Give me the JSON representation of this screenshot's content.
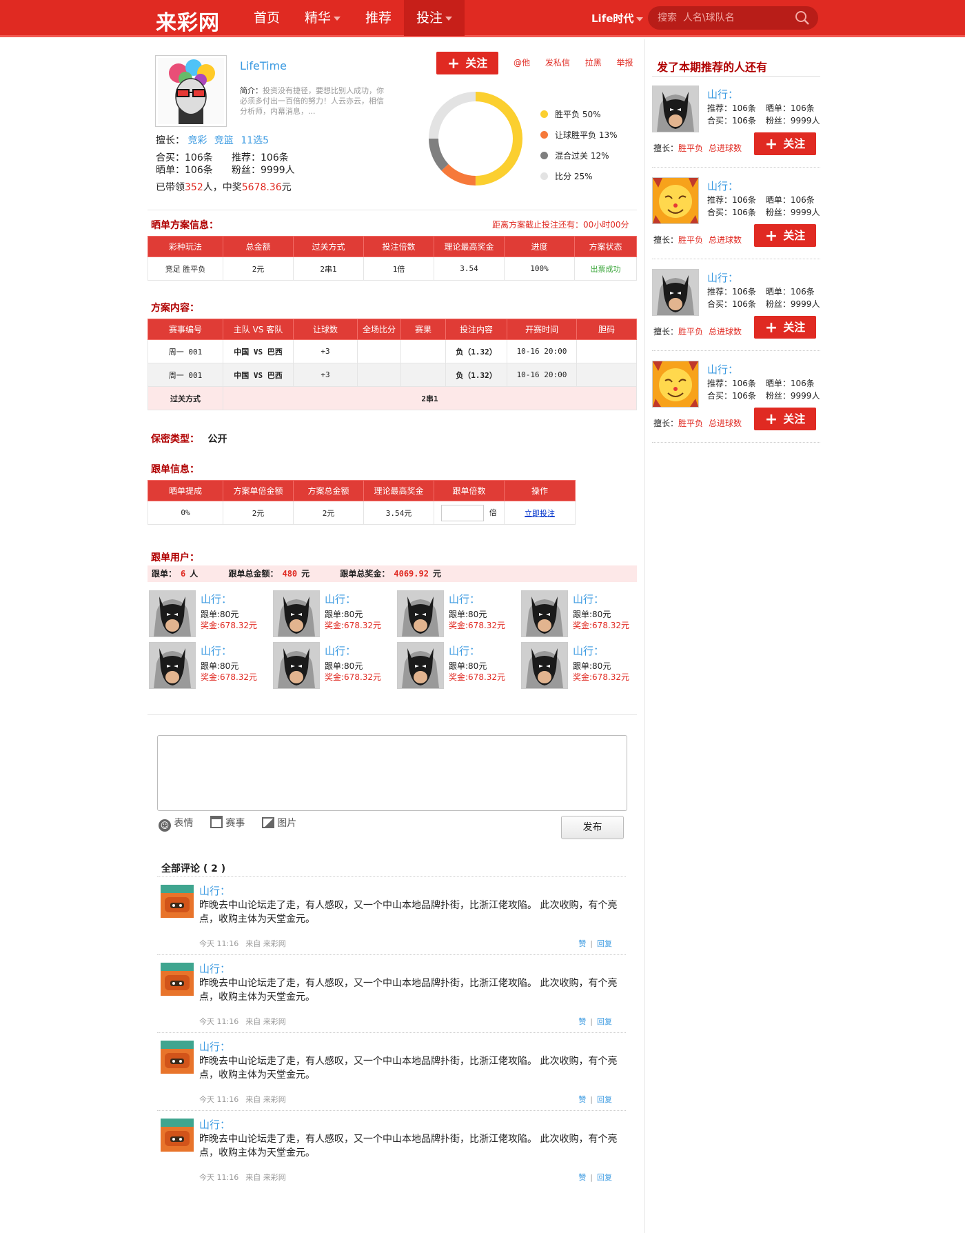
{
  "header": {
    "logo": "来彩网",
    "nav": [
      {
        "label": "首页",
        "caret": false,
        "active": false
      },
      {
        "label": "精华",
        "caret": true,
        "active": false
      },
      {
        "label": "推荐",
        "caret": false,
        "active": false
      },
      {
        "label": "投注",
        "caret": true,
        "active": true
      }
    ],
    "user": "Life时代",
    "search_placeholder": "搜索  人名\\球队名"
  },
  "profile": {
    "name": "LifeTime",
    "intro_label": "简介：",
    "intro": "投资没有捷径，要想比别人成功，你必须多付出一百倍的努力！人云亦云，相信分析师，内幕消息，...",
    "specialty_label": "擅长：",
    "specialties": [
      "竞彩",
      "竞篮",
      "11选5"
    ],
    "stats": {
      "heimai": "合买：106条",
      "tuijian": "推荐：106条",
      "shaidan": "晒单：106条",
      "fensi": "粉丝：9999人"
    },
    "lead_prefix": "已带领",
    "lead_count": "352",
    "lead_mid": "人，中奖",
    "lead_amount": "5678.36",
    "lead_suffix": "元",
    "follow_label": "关注",
    "actions": [
      "@他",
      "发私信",
      "拉黑",
      "举报"
    ]
  },
  "donut": {
    "segments": [
      {
        "label": "胜平负",
        "percent": 50,
        "color": "#fbcf2f"
      },
      {
        "label": "让球胜平负",
        "percent": 13,
        "color": "#f6793a"
      },
      {
        "label": "混合过关",
        "percent": 12,
        "color": "#7f7f7f"
      },
      {
        "label": "比分",
        "percent": 25,
        "color": "#e3e3e3"
      }
    ],
    "legend": [
      "胜平负  50%",
      "让球胜平负  13%",
      "混合过关  12%",
      "比分  25%"
    ]
  },
  "plan_info": {
    "title": "晒单方案信息：",
    "countdown": "距离方案截止投注还有：00小时00分",
    "headers": [
      "彩种玩法",
      "总金额",
      "过关方式",
      "投注倍数",
      "理论最高奖金",
      "进度",
      "方案状态"
    ],
    "row": [
      "竞足 胜平负",
      "2元",
      "2串1",
      "1倍",
      "3.54",
      "100%",
      "出票成功"
    ]
  },
  "plan_content": {
    "title": "方案内容：",
    "headers": [
      "赛事编号",
      "主队 VS 客队",
      "让球数",
      "全场比分",
      "赛果",
      "投注内容",
      "开赛时间",
      "胆码"
    ],
    "rows": [
      [
        "周一 001",
        "中国 VS 巴西",
        "+3",
        "",
        "",
        "负（1.32）",
        "10-16 20:00",
        ""
      ],
      [
        "周一 001",
        "中国 VS 巴西",
        "+3",
        "",
        "",
        "负（1.32）",
        "10-16 20:00",
        ""
      ]
    ],
    "pass_label": "过关方式",
    "pass_value": "2串1"
  },
  "secrecy": {
    "label": "保密类型：",
    "value": "公开"
  },
  "follow_info": {
    "title": "跟单信息：",
    "headers": [
      "晒单提成",
      "方案单倍金额",
      "方案总金额",
      "理论最高奖金",
      "跟单倍数",
      "操作"
    ],
    "row": [
      "0%",
      "2元",
      "2元",
      "3.54元",
      "倍",
      "立即投注"
    ]
  },
  "follow_users": {
    "title": "跟单用户：",
    "summary": {
      "count_label": "跟单：",
      "count": "6",
      "count_unit": "人",
      "total_label": "跟单总金额：",
      "total": "480",
      "total_unit": "元",
      "prize_label": "跟单总奖金：",
      "prize": "4069.92",
      "prize_unit": "元"
    },
    "users": [
      {
        "name": "山行：",
        "amount": "跟单:80元",
        "prize": "奖金:678.32元"
      },
      {
        "name": "山行：",
        "amount": "跟单:80元",
        "prize": "奖金:678.32元"
      },
      {
        "name": "山行：",
        "amount": "跟单:80元",
        "prize": "奖金:678.32元"
      },
      {
        "name": "山行：",
        "amount": "跟单:80元",
        "prize": "奖金:678.32元"
      },
      {
        "name": "山行：",
        "amount": "跟单:80元",
        "prize": "奖金:678.32元"
      },
      {
        "name": "山行：",
        "amount": "跟单:80元",
        "prize": "奖金:678.32元"
      },
      {
        "name": "山行：",
        "amount": "跟单:80元",
        "prize": "奖金:678.32元"
      },
      {
        "name": "山行：",
        "amount": "跟单:80元",
        "prize": "奖金:678.32元"
      }
    ]
  },
  "composer": {
    "tools": [
      "表情",
      "赛事",
      "图片"
    ],
    "submit": "发布"
  },
  "comments": {
    "title": "全部评论 ( 2 )",
    "items": [
      {
        "name": "山行：",
        "text": "昨晚去中山论坛走了走，有人感叹，又一个中山本地品牌扑街，比浙江佬攻陷。 此次收购，有个亮点，收购主体为天堂金元。",
        "time": "今天 11:16",
        "source": "来自 来彩网",
        "like": "赞",
        "reply": "回复"
      },
      {
        "name": "山行：",
        "text": "昨晚去中山论坛走了走，有人感叹，又一个中山本地品牌扑街，比浙江佬攻陷。 此次收购，有个亮点，收购主体为天堂金元。",
        "time": "今天 11:16",
        "source": "来自 来彩网",
        "like": "赞",
        "reply": "回复"
      },
      {
        "name": "山行：",
        "text": "昨晚去中山论坛走了走，有人感叹，又一个中山本地品牌扑街，比浙江佬攻陷。 此次收购，有个亮点，收购主体为天堂金元。",
        "time": "今天 11:16",
        "source": "来自 来彩网",
        "like": "赞",
        "reply": "回复"
      },
      {
        "name": "山行：",
        "text": "昨晚去中山论坛走了走，有人感叹，又一个中山本地品牌扑街，比浙江佬攻陷。 此次收购，有个亮点，收购主体为天堂金元。",
        "time": "今天 11:16",
        "source": "来自 来彩网",
        "like": "赞",
        "reply": "回复"
      }
    ]
  },
  "sidebar": {
    "title": "发了本期推荐的人还有",
    "cards": [
      {
        "name": "山行：",
        "tuijian": "推荐：106条",
        "shaidan": "晒单：106条",
        "heimai": "合买：106条",
        "fensi": "粉丝：9999人",
        "spec_label": "擅长：",
        "spec1": "胜平负",
        "spec2": "总进球数",
        "follow": "关注",
        "avatar": "batman"
      },
      {
        "name": "山行：",
        "tuijian": "推荐：106条",
        "shaidan": "晒单：106条",
        "heimai": "合买：106条",
        "fensi": "粉丝：9999人",
        "spec_label": "擅长：",
        "spec1": "胜平负",
        "spec2": "总进球数",
        "follow": "关注",
        "avatar": "cat"
      },
      {
        "name": "山行：",
        "tuijian": "推荐：106条",
        "shaidan": "晒单：106条",
        "heimai": "合买：106条",
        "fensi": "粉丝：9999人",
        "spec_label": "擅长：",
        "spec1": "胜平负",
        "spec2": "总进球数",
        "follow": "关注",
        "avatar": "batman"
      },
      {
        "name": "山行：",
        "tuijian": "推荐：106条",
        "shaidan": "晒单：106条",
        "heimai": "合买：106条",
        "fensi": "粉丝：9999人",
        "spec_label": "擅长：",
        "spec1": "胜平负",
        "spec2": "总进球数",
        "follow": "关注",
        "avatar": "cat"
      }
    ]
  },
  "colors": {
    "brand_red": "#e02a22",
    "link_blue": "#3b9ae1",
    "section_title": "#b00000"
  }
}
